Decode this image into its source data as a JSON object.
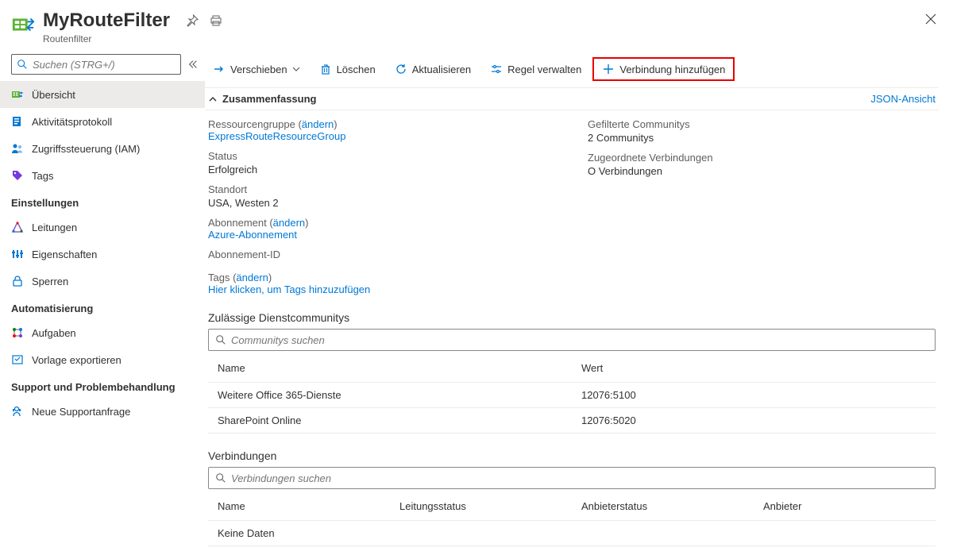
{
  "header": {
    "title": "MyRouteFilter",
    "subtitle": "Routenfilter"
  },
  "search": {
    "placeholder": "Suchen (STRG+/)"
  },
  "nav": {
    "items_top": [
      {
        "label": "Übersicht"
      },
      {
        "label": "Aktivitätsprotokoll"
      },
      {
        "label": "Zugriffssteuerung (IAM)"
      },
      {
        "label": "Tags"
      }
    ],
    "section_settings": "Einstellungen",
    "items_settings": [
      {
        "label": "Leitungen"
      },
      {
        "label": "Eigenschaften"
      },
      {
        "label": "Sperren"
      }
    ],
    "section_auto": "Automatisierung",
    "items_auto": [
      {
        "label": "Aufgaben"
      },
      {
        "label": "Vorlage exportieren"
      }
    ],
    "section_support": "Support und Problembehandlung",
    "items_support": [
      {
        "label": "Neue Supportanfrage"
      }
    ]
  },
  "toolbar": {
    "move": "Verschieben",
    "delete": "Löschen",
    "refresh": "Aktualisieren",
    "manage_rule": "Regel verwalten",
    "add_connection": "Verbindung hinzufügen"
  },
  "summary": {
    "header": "Zusammenfassung",
    "json_view": "JSON-Ansicht",
    "resourcegroup_label_prefix": "Ressourcengruppe (",
    "change": "ändern",
    "paren_close": ")",
    "resourcegroup_value": "ExpressRouteResourceGroup",
    "status_label": "Status",
    "status_value": "Erfolgreich",
    "location_label": "Standort",
    "location_value": "USA, Westen 2",
    "subscription_label_prefix": "Abonnement (",
    "subscription_value": "Azure-Abonnement",
    "subscription_id_label": "Abonnement-ID",
    "communities_label": "Gefilterte Communitys",
    "communities_value": "2 Communitys",
    "connections_label": "Zugeordnete Verbindungen",
    "connections_value": "O Verbindungen",
    "tags_prefix": "Tags (",
    "tags_action": "Hier klicken, um Tags hinzuzufügen"
  },
  "communities": {
    "heading": "Zulässige Dienstcommunitys",
    "search_placeholder": "Communitys suchen",
    "col_name": "Name",
    "col_value": "Wert",
    "rows": [
      {
        "name": "Weitere Office 365-Dienste",
        "value": "12076:5100"
      },
      {
        "name": "SharePoint Online",
        "value": "12076:5020"
      }
    ]
  },
  "connections": {
    "heading": "Verbindungen",
    "search_placeholder": "Verbindungen suchen",
    "col_name": "Name",
    "col_circuit": "Leitungsstatus",
    "col_provider_status": "Anbieterstatus",
    "col_provider": "Anbieter",
    "empty": "Keine Daten"
  }
}
